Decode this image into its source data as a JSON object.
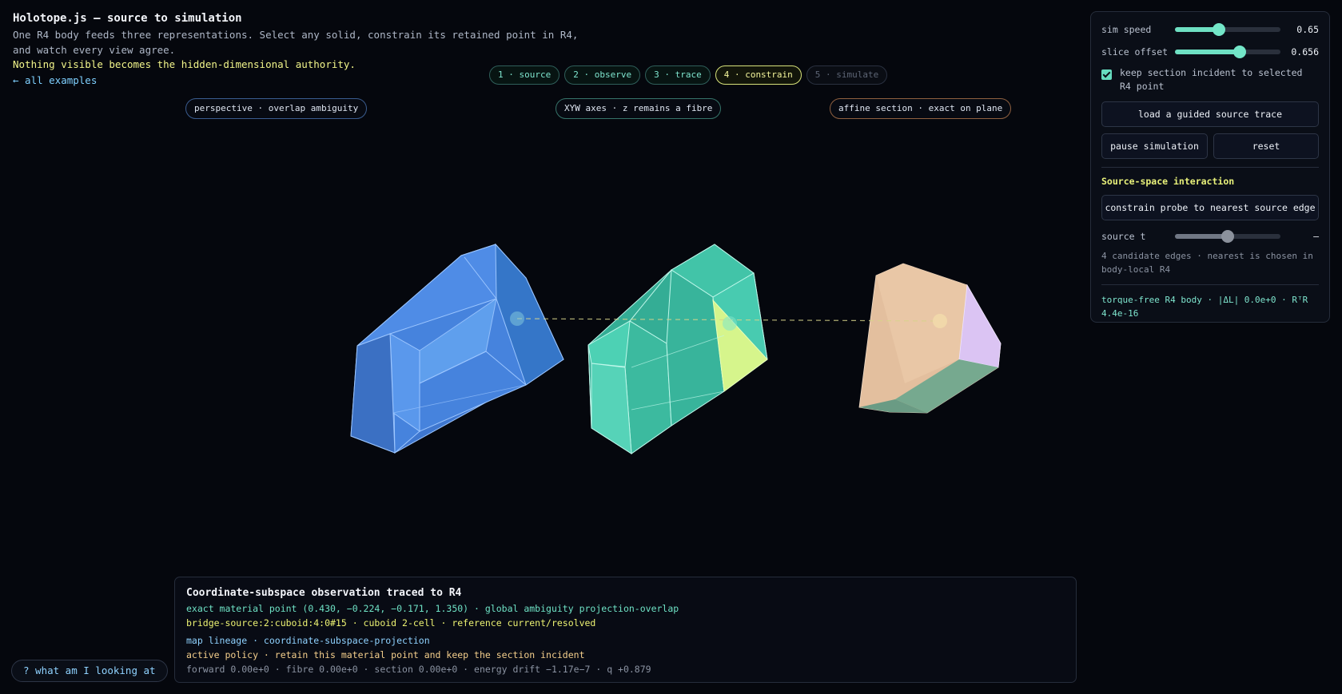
{
  "header": {
    "title": "Holotope.js — source to simulation",
    "subtitle": "One R4 body feeds three representations. Select any solid, constrain its retained point in R4, and watch every view agree.",
    "warning": "Nothing visible becomes the hidden-dimensional authority.",
    "back_link": "← all examples"
  },
  "stepper": [
    {
      "label": "1 · source",
      "state": "done"
    },
    {
      "label": "2 · observe",
      "state": "done"
    },
    {
      "label": "3 · trace",
      "state": "done"
    },
    {
      "label": "4 · constrain",
      "state": "active"
    },
    {
      "label": "5 · simulate",
      "state": "disabled"
    }
  ],
  "views": {
    "perspective": "perspective · overlap ambiguity",
    "xyw": "XYW axes · z remains a fibre",
    "affine": "affine section · exact on plane"
  },
  "panel": {
    "sim_speed": {
      "label": "sim speed",
      "value": "0.65",
      "fraction": 0.42
    },
    "slice_offset": {
      "label": "slice offset",
      "value": "0.656",
      "fraction": 0.61
    },
    "keep_section": {
      "label": "keep section incident to selected R4 point",
      "checked": true
    },
    "guided_button": "load a guided source trace",
    "pause_button": "pause simulation",
    "reset_button": "reset",
    "section_heading": "Source-space interaction",
    "constrain_button": "constrain probe to nearest source edge",
    "source_t": {
      "label": "source t",
      "value": "–",
      "fraction": 0.5
    },
    "candidates": "4 candidate edges · nearest is chosen in body-local R4",
    "torque": "torque-free R4 body · |ΔL| 0.0e+0 · RᵀR 4.4e-16"
  },
  "info": {
    "title": "Coordinate-subspace observation traced to R4",
    "line1": "exact material point (0.430, −0.224, −0.171, 1.350) · global ambiguity projection-overlap",
    "line2": "bridge-source:2:cuboid:4:0#15 · cuboid 2-cell · reference current/resolved",
    "line3": "map lineage · coordinate-subspace-projection",
    "line4": "active policy · retain this material point and keep the section incident",
    "line5": "forward 0.00e+0 · fibre 0.00e+0 · section 0.00e+0 · energy drift −1.17e−7 · q +0.879"
  },
  "help_button": "? what am I looking at",
  "colors": {
    "background": "#05070d",
    "accent_teal": "#6ee0c3",
    "accent_yellow": "#ecf272",
    "solid_blue": "#4a86e0",
    "solid_teal": "#45c9ad",
    "solid_peach": "#e7c2a0",
    "solid_lilac": "#dcc6f5",
    "highlight_lime": "#d9f58a"
  }
}
